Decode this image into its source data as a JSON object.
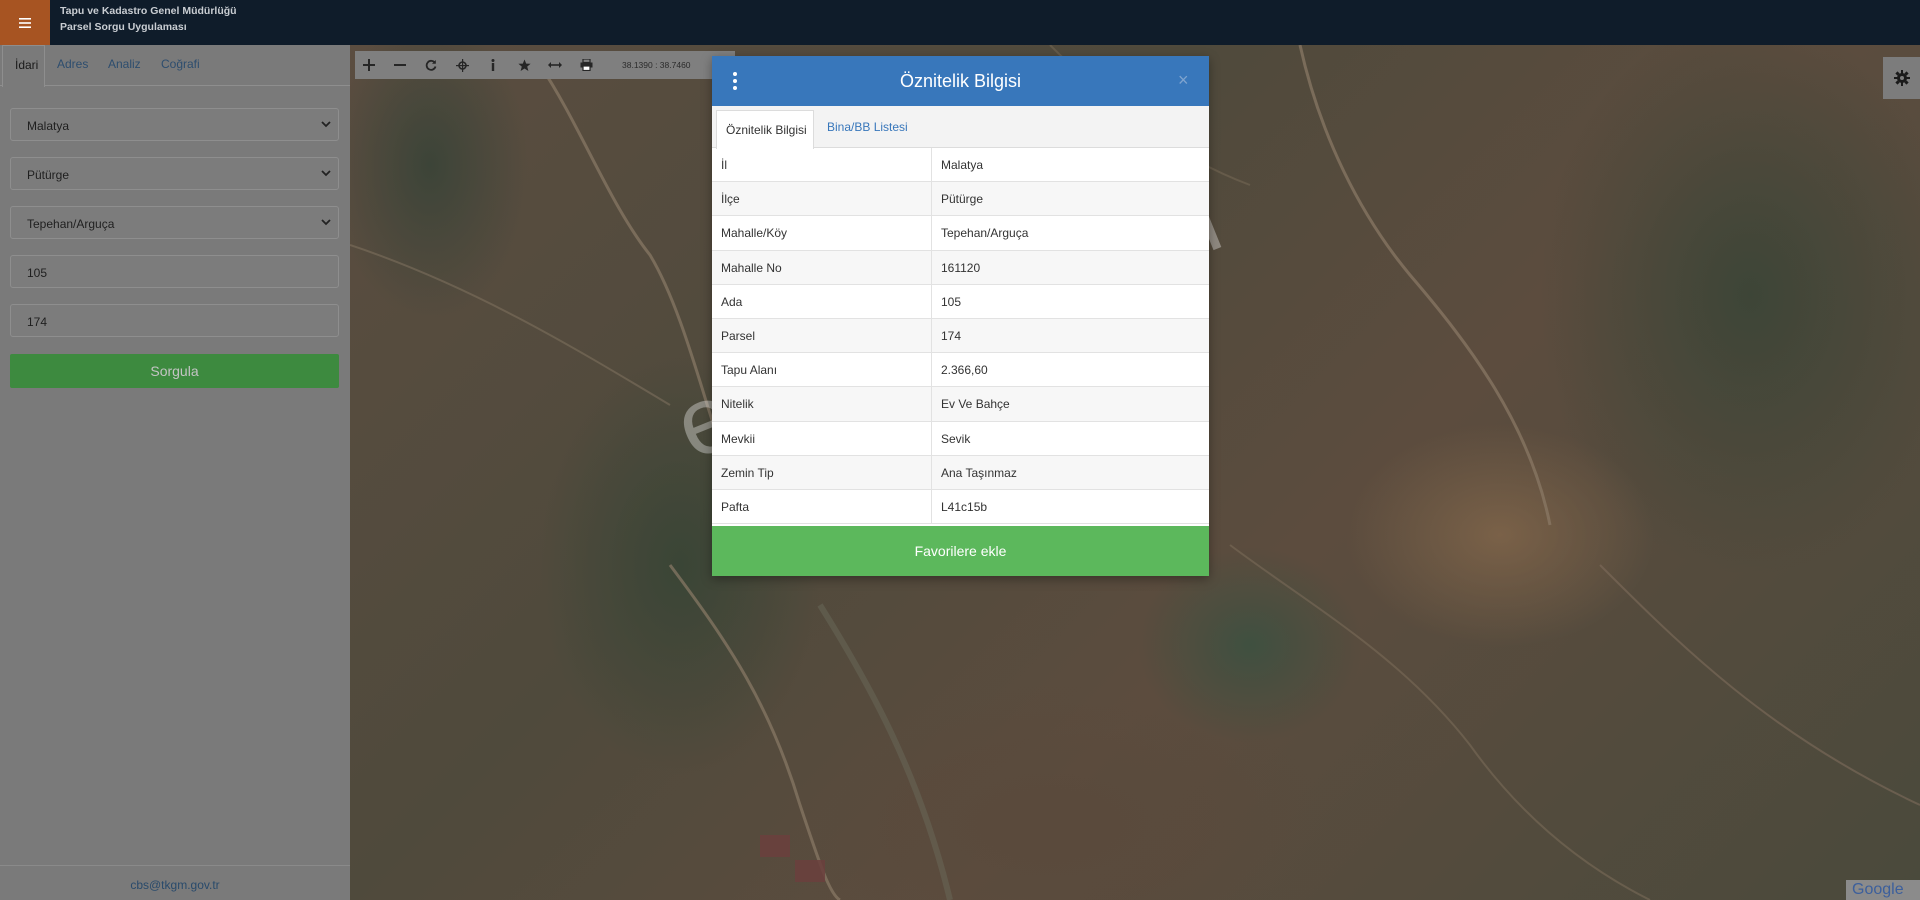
{
  "header": {
    "menu_icon": "hamburger-icon",
    "org_name": "Tapu ve Kadastro Genel Müdürlüğü",
    "app_name": "Parsel Sorgu Uygulaması"
  },
  "sidebar": {
    "tabs": [
      {
        "label": "İdari"
      },
      {
        "label": "Adres"
      },
      {
        "label": "Analiz"
      },
      {
        "label": "Coğrafi"
      }
    ],
    "il_select": "Malatya",
    "ilce_select": "Pütürge",
    "mahalle_select": "Tepehan/Arguça",
    "ada_input": "105",
    "parsel_input": "174",
    "query_button": "Sorgula",
    "footer_email": "cbs@tkgm.gov.tr"
  },
  "toolbar": {
    "icons": [
      "zoom-in-icon",
      "zoom-out-icon",
      "refresh-icon",
      "locate-icon",
      "info-icon",
      "favorite-star-icon",
      "measure-icon",
      "print-icon"
    ],
    "coordinates": "38.1390 : 38.7460"
  },
  "map": {
    "settings_icon": "gear-icon",
    "attribution": "Google",
    "watermark": "emlakjet.com"
  },
  "dialog": {
    "title": "Öznitelik Bilgisi",
    "menu_icon": "kebab-menu-icon",
    "close_label": "×",
    "tabs": [
      {
        "label": "Öznitelik Bilgisi"
      },
      {
        "label": "Bina/BB Listesi"
      }
    ],
    "rows": [
      {
        "key": "İl",
        "value": "Malatya"
      },
      {
        "key": "İlçe",
        "value": "Pütürge"
      },
      {
        "key": "Mahalle/Köy",
        "value": "Tepehan/Arguça"
      },
      {
        "key": "Mahalle No",
        "value": "161120"
      },
      {
        "key": "Ada",
        "value": "105"
      },
      {
        "key": "Parsel",
        "value": "174"
      },
      {
        "key": "Tapu Alanı",
        "value": "2.366,60"
      },
      {
        "key": "Nitelik",
        "value": "Ev Ve Bahçe"
      },
      {
        "key": "Mevkii",
        "value": "Sevik"
      },
      {
        "key": "Zemin Tip",
        "value": "Ana Taşınmaz"
      },
      {
        "key": "Pafta",
        "value": "L41c15b"
      }
    ],
    "favorite_button": "Favorilere ekle"
  },
  "colors": {
    "header_bg": "#0f1c2a",
    "menu_accent": "#a75422",
    "dialog_header": "#3877bb",
    "favorite_green": "#5cb85c",
    "query_green": "#3d8a3f"
  }
}
